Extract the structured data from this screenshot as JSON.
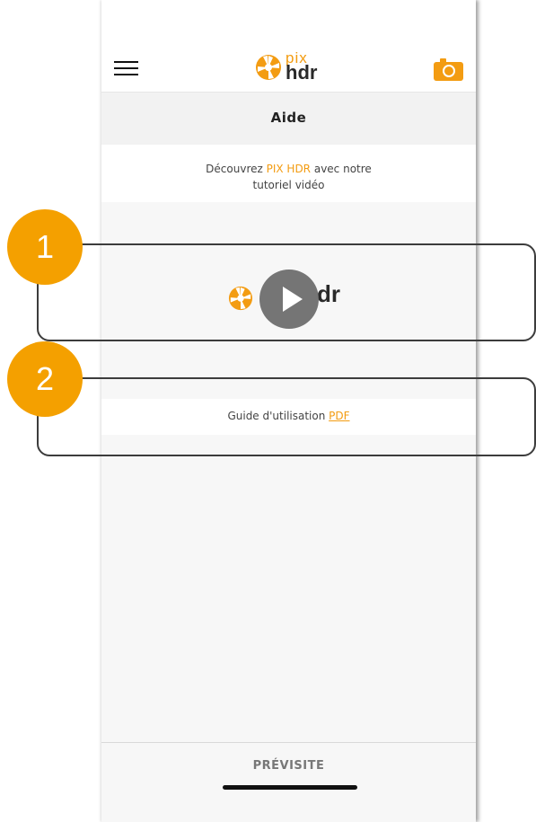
{
  "app": {
    "name_pix": "pix",
    "name_hdr": "hdr"
  },
  "header": {
    "title": "Aide"
  },
  "intro": {
    "prefix": "Découvrez ",
    "highlight": "PIX HDR",
    "suffix": " avec notre",
    "line2": "tutoriel vidéo"
  },
  "video": {
    "logo_text": "dr"
  },
  "guide": {
    "label": "Guide d'utilisation ",
    "link": "PDF"
  },
  "footer": {
    "brand": "PRÉVISITE"
  },
  "callouts": [
    {
      "number": "1"
    },
    {
      "number": "2"
    }
  ],
  "colors": {
    "accent": "#f39c12",
    "callout": "#f4a000"
  },
  "icons": {
    "menu": "hamburger-icon",
    "camera": "camera-icon",
    "play": "play-icon",
    "logo": "aperture-icon"
  }
}
